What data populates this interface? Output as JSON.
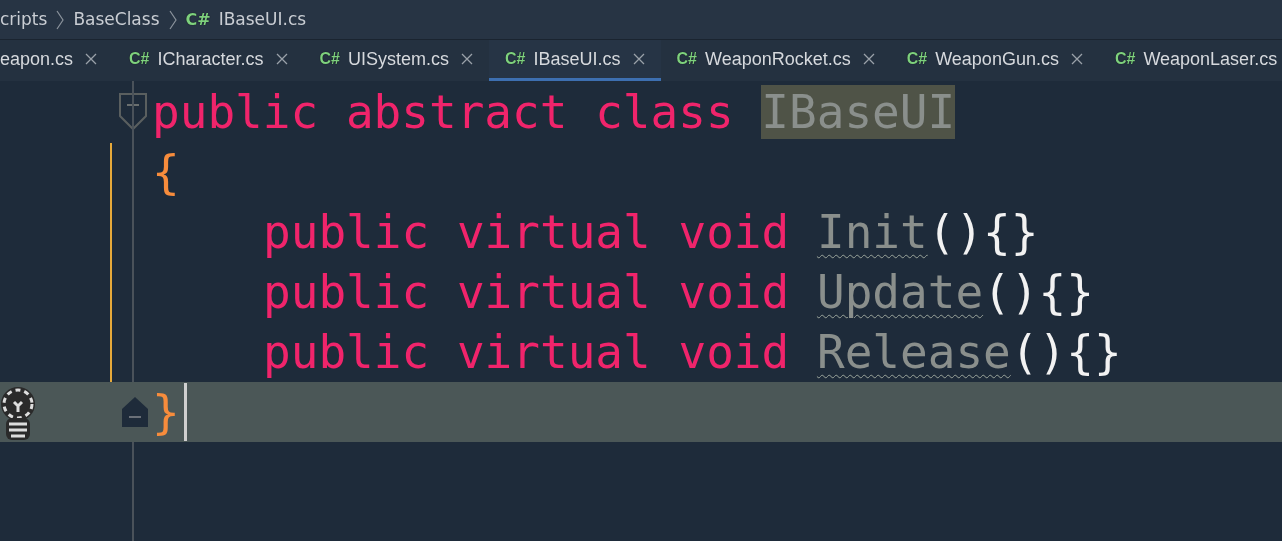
{
  "breadcrumb": [
    {
      "label": "cripts"
    },
    {
      "label": "BaseClass"
    },
    {
      "label": "IBaseUI.cs",
      "icon": "C#"
    }
  ],
  "tabs": [
    {
      "label": "eapon.cs",
      "close": true,
      "selected": false
    },
    {
      "label": "ICharacter.cs",
      "icon": "C#",
      "close": true,
      "selected": false
    },
    {
      "label": "UISystem.cs",
      "icon": "C#",
      "close": true,
      "selected": false
    },
    {
      "label": "IBaseUI.cs",
      "icon": "C#",
      "close": true,
      "selected": true
    },
    {
      "label": "WeaponRocket.cs",
      "icon": "C#",
      "close": true,
      "selected": false
    },
    {
      "label": "WeaponGun.cs",
      "icon": "C#",
      "close": true,
      "selected": false
    },
    {
      "label": "WeaponLaser.cs",
      "icon": "C#",
      "close": false,
      "selected": false
    }
  ],
  "code": {
    "declaration": [
      {
        "text": "public",
        "kind": "keyword"
      },
      {
        "text": "abstract",
        "kind": "keyword"
      },
      {
        "text": "class",
        "kind": "keyword"
      },
      {
        "text": "IBaseUI",
        "kind": "highlighted"
      }
    ],
    "open": "{",
    "members": [
      [
        {
          "text": "public",
          "kind": "keyword"
        },
        {
          "text": "virtual",
          "kind": "keyword"
        },
        {
          "text": "void",
          "kind": "keyword"
        },
        {
          "text": "Init",
          "kind": "unused"
        },
        {
          "text": "(){}",
          "kind": "punct"
        }
      ],
      [
        {
          "text": "public",
          "kind": "keyword"
        },
        {
          "text": "virtual",
          "kind": "keyword"
        },
        {
          "text": "void",
          "kind": "keyword"
        },
        {
          "text": "Update",
          "kind": "unused"
        },
        {
          "text": "(){}",
          "kind": "punct"
        }
      ],
      [
        {
          "text": "public",
          "kind": "keyword"
        },
        {
          "text": "virtual",
          "kind": "keyword"
        },
        {
          "text": "void",
          "kind": "keyword"
        },
        {
          "text": "Release",
          "kind": "unused"
        },
        {
          "text": "(){}",
          "kind": "punct"
        }
      ]
    ],
    "close": "}",
    "current_line": true
  }
}
